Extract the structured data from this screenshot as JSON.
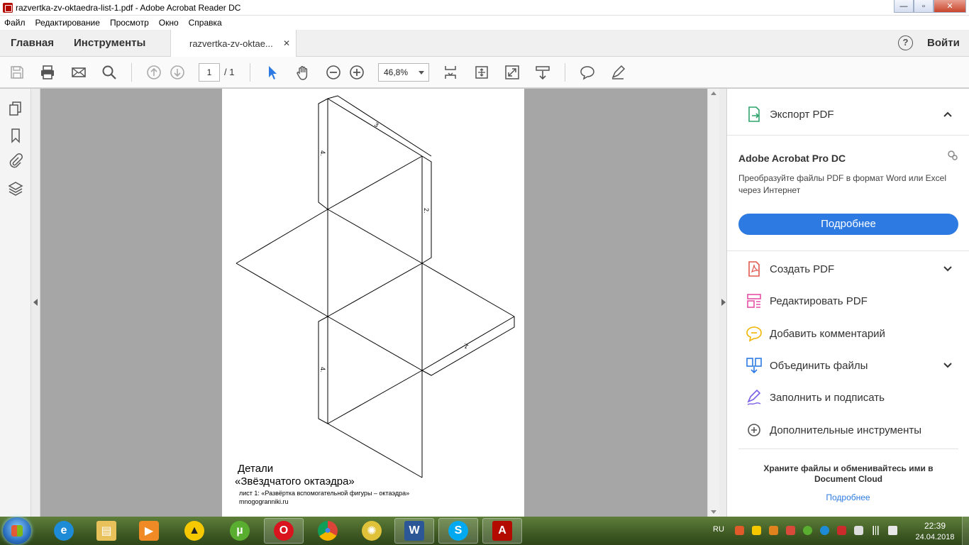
{
  "window": {
    "title": "razvertka-zv-oktaedra-list-1.pdf - Adobe Acrobat Reader DC",
    "minimize": "—",
    "maximize": "▫",
    "close": "✕"
  },
  "menu": [
    "Файл",
    "Редактирование",
    "Просмотр",
    "Окно",
    "Справка"
  ],
  "tabs": {
    "home": "Главная",
    "tools": "Инструменты",
    "document": "razvertka-zv-oktae...",
    "close": "✕",
    "help": "?",
    "signin": "Войти"
  },
  "toolbar": {
    "page_current": "1",
    "page_total": "/ 1",
    "zoom": "46,8%"
  },
  "document": {
    "edge_labels": {
      "top": "3",
      "left_upper": "4.",
      "right": "2.",
      "right_lower": "1.",
      "left_lower": "4."
    },
    "caption_line1": "Детали",
    "caption_line2": "«Звёздчатого октаэдра»",
    "caption_sheet": "лист 1: «Развёртка вспомогательной фигуры – октаэдра»",
    "caption_site": "mnogogranniki.ru"
  },
  "right_panel": {
    "export_label": "Экспорт PDF",
    "promo_title": "Adobe Acrobat Pro DC",
    "promo_text": "Преобразуйте файлы PDF в формат Word или Excel через Интернет",
    "promo_button": "Подробнее",
    "tools": [
      {
        "label": "Создать PDF",
        "icon": "create-pdf-icon",
        "color": "#e05a4f"
      },
      {
        "label": "Редактировать PDF",
        "icon": "edit-pdf-icon",
        "color": "#e74fa6"
      },
      {
        "label": "Добавить комментарий",
        "icon": "comment-icon",
        "color": "#f2b400"
      },
      {
        "label": "Объединить файлы",
        "icon": "combine-files-icon",
        "color": "#2d7be2"
      },
      {
        "label": "Заполнить и подписать",
        "icon": "fill-sign-icon",
        "color": "#7a5ee8"
      },
      {
        "label": "Дополнительные инструменты",
        "icon": "more-tools-icon",
        "color": "#555555"
      }
    ],
    "cloud_text": "Храните файлы и обменивайтесь ими в Document Cloud",
    "cloud_link": "Подробнее"
  },
  "taskbar": {
    "language": "RU",
    "time": "22:39",
    "date": "24.04.2018",
    "apps": [
      {
        "name": "internet-explorer-icon",
        "color": "#1e8bd6",
        "glyph": "e"
      },
      {
        "name": "file-explorer-icon",
        "color": "#e8c15a",
        "glyph": "▤"
      },
      {
        "name": "media-player-icon",
        "color": "#f08a24",
        "glyph": "▶"
      },
      {
        "name": "archicad-icon",
        "color": "#f6c800",
        "glyph": "▲"
      },
      {
        "name": "utorrent-icon",
        "color": "#5aae2f",
        "glyph": "µ"
      },
      {
        "name": "opera-icon",
        "color": "#d9141e",
        "glyph": "O"
      },
      {
        "name": "chrome-icon",
        "color": "#3aa757",
        "glyph": "●"
      },
      {
        "name": "lemon-app-icon",
        "color": "#e0c23a",
        "glyph": "✺"
      },
      {
        "name": "word-icon",
        "color": "#2b5797",
        "glyph": "W"
      },
      {
        "name": "skype-icon",
        "color": "#00a9f0",
        "glyph": "S"
      },
      {
        "name": "acrobat-icon",
        "color": "#b30b00",
        "glyph": "A"
      }
    ]
  }
}
